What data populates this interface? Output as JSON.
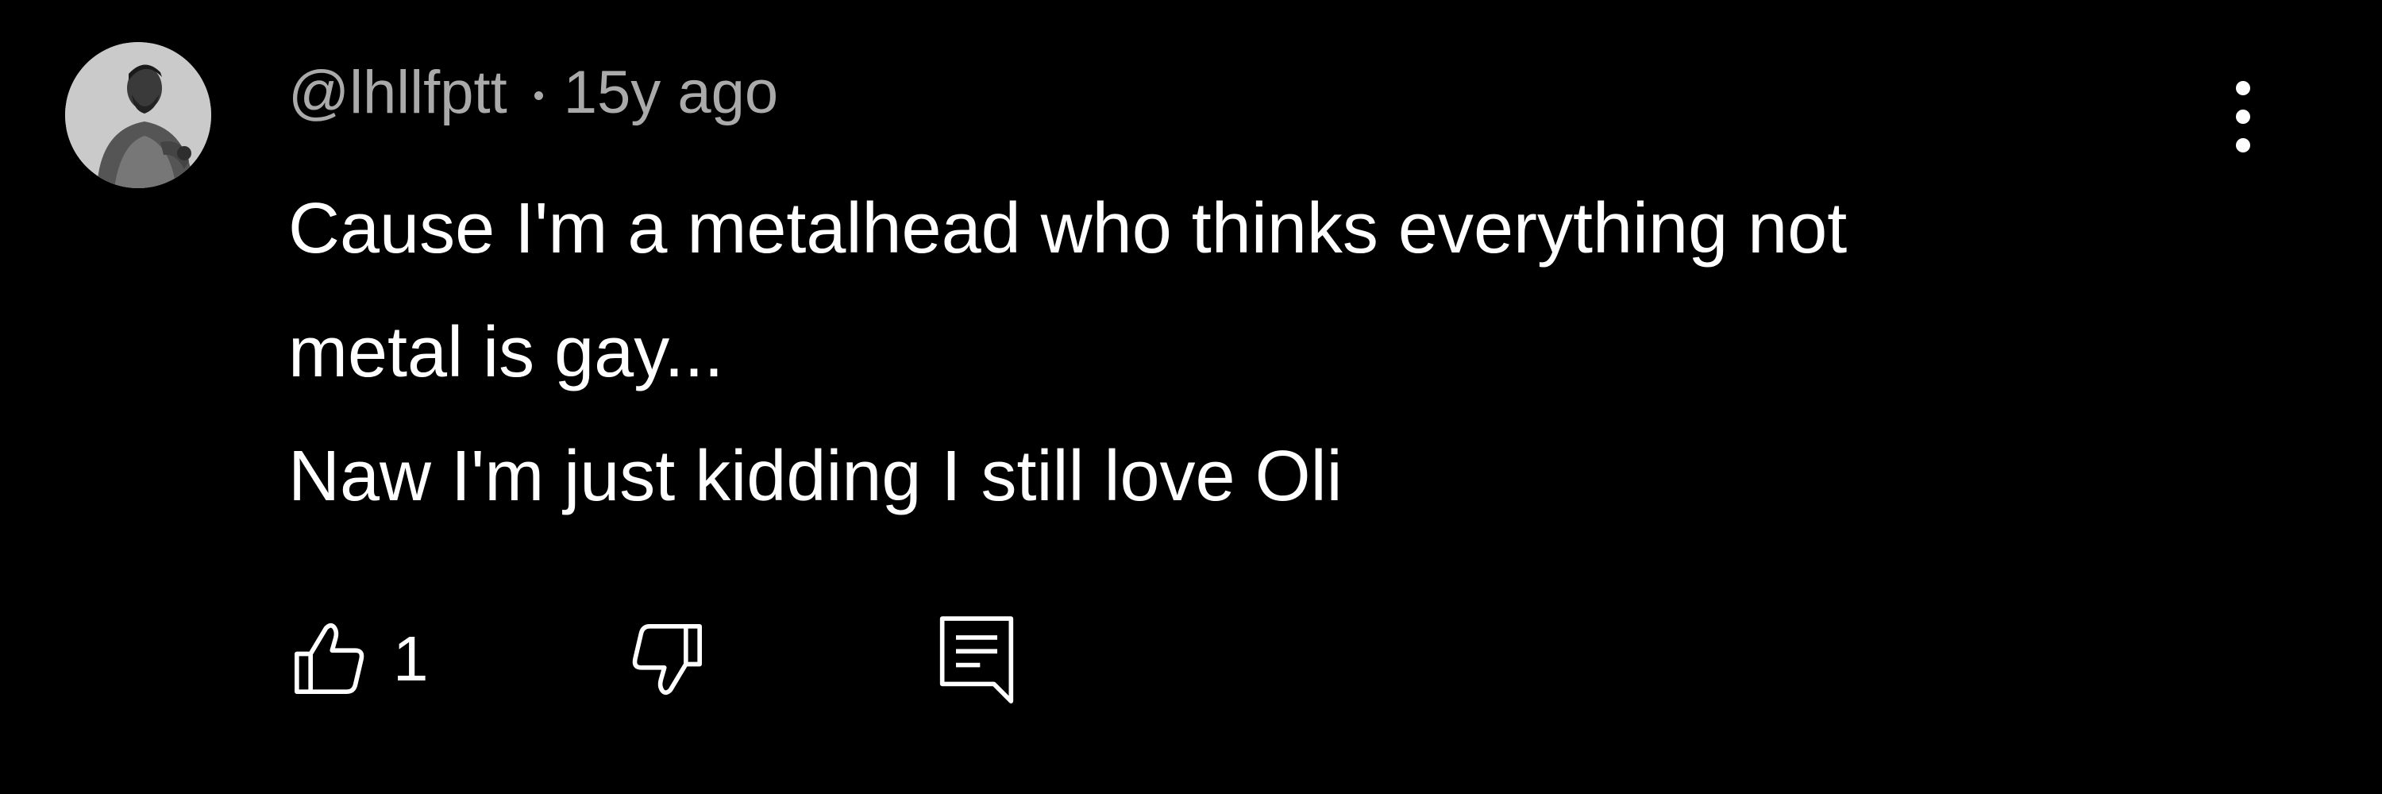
{
  "comment": {
    "author": "@lhllfptt",
    "separator": "•",
    "timestamp": "15y ago",
    "lines": [
      "Cause I'm a metalhead who thinks everything not",
      "metal is gay...",
      "Naw I'm just kidding I still love Oli"
    ],
    "like_count": "1"
  },
  "icons": {
    "avatar": "avatar-photo",
    "more": "kebab-menu-icon",
    "like": "thumbs-up-icon",
    "dislike": "thumbs-down-icon",
    "reply": "reply-comment-icon"
  },
  "colors": {
    "background": "#000000",
    "primary_text": "#ffffff",
    "secondary_text": "#aaaaaa"
  }
}
